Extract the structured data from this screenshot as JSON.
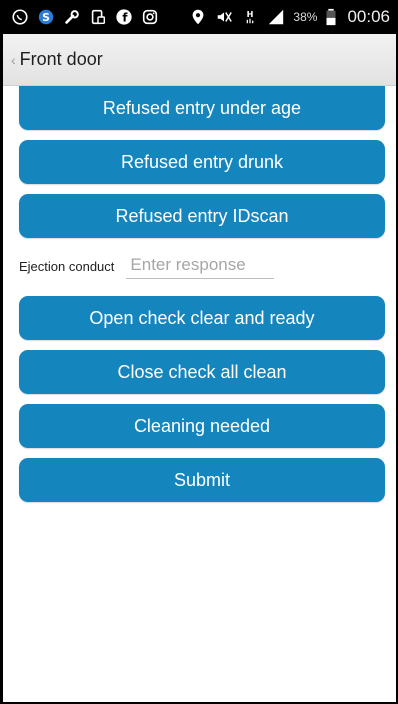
{
  "status_bar": {
    "icons_left": [
      "whatsapp-icon",
      "skype-icon",
      "wrench-icon",
      "tablet-icon",
      "facebook-icon",
      "instagram-icon"
    ],
    "icons_right": [
      "location-icon",
      "mute-icon",
      "signal-h-icon",
      "cell-signal-icon",
      "battery-icon"
    ],
    "battery_percent": "38%",
    "time": "00:06"
  },
  "header": {
    "back_glyph": "‹",
    "title": "Front door"
  },
  "buttons_top": [
    {
      "label": "Refused entry under age"
    },
    {
      "label": "Refused entry drunk"
    },
    {
      "label": "Refused entry IDscan"
    }
  ],
  "field": {
    "label": "Ejection conduct",
    "placeholder": "Enter response",
    "value": ""
  },
  "buttons_bottom": [
    {
      "label": "Open check clear and ready"
    },
    {
      "label": "Close check all clean"
    },
    {
      "label": "Cleaning needed"
    },
    {
      "label": "Submit"
    }
  ],
  "colors": {
    "button_bg": "#1585be",
    "button_text": "#ffffff",
    "header_bg": "#e9e9e9",
    "status_bar_bg": "#000000"
  }
}
